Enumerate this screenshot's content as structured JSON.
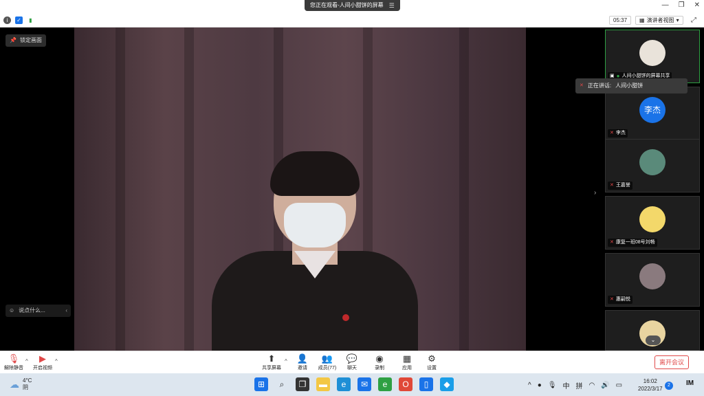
{
  "title_bar": {
    "viewing_text": "您正在观看-人间小甜饼的屏幕",
    "menu_icon": "menu-icon",
    "minimize": "—",
    "restore": "❐",
    "close": "✕"
  },
  "info_bar": {
    "timer": "05:37",
    "view_label": "演讲者视图",
    "view_caret": "▾",
    "fullscreen_icon": "⤢"
  },
  "main": {
    "lock_label": "锁定画面",
    "lock_icon": "📌",
    "chat_placeholder": "说点什么...",
    "chat_icon": "☺",
    "chat_chevron": "‹",
    "collapse_chevron": "›"
  },
  "sidebar": {
    "speaking_prefix": "正在讲话:",
    "speaking_name": "人间小甜饼",
    "participants": [
      {
        "name": "人间小甜饼的屏幕共享",
        "avatar_text": "",
        "avatar_color": "#e9e3da",
        "sharing": true
      },
      {
        "name": "李杰",
        "avatar_text": "李杰",
        "avatar_color": "#1a73e8",
        "sharing": false
      },
      {
        "name": "王嘉誉",
        "avatar_text": "",
        "avatar_color": "#5a8a7a",
        "sharing": false
      },
      {
        "name": "康复一班08号刘畅",
        "avatar_text": "",
        "avatar_color": "#f3d86a",
        "sharing": false
      },
      {
        "name": "惠嗣悦",
        "avatar_text": "",
        "avatar_color": "#8a7a7e",
        "sharing": false
      },
      {
        "name": "",
        "avatar_text": "",
        "avatar_color": "#e8d4a0",
        "sharing": false
      }
    ],
    "scroll_down": "⌄"
  },
  "toolbar": {
    "unmute_label": "解除静音",
    "video_label": "开启视频",
    "share_label": "共享屏幕",
    "invite_label": "邀请",
    "members_label": "成员(77)",
    "chat_label": "聊天",
    "record_label": "录制",
    "apps_label": "应用",
    "settings_label": "设置",
    "leave_label": "离开会议",
    "caret": "^"
  },
  "taskbar": {
    "temperature": "4°C",
    "weather": "阴",
    "time": "16:02",
    "date": "2022/3/17",
    "notifications": "2",
    "ime_lang": "中",
    "ime_mode": "拼",
    "tray_caret": "^"
  },
  "colors": {
    "accent_blue": "#1a73e8",
    "danger_red": "#e04848",
    "active_green": "#2ea043"
  }
}
